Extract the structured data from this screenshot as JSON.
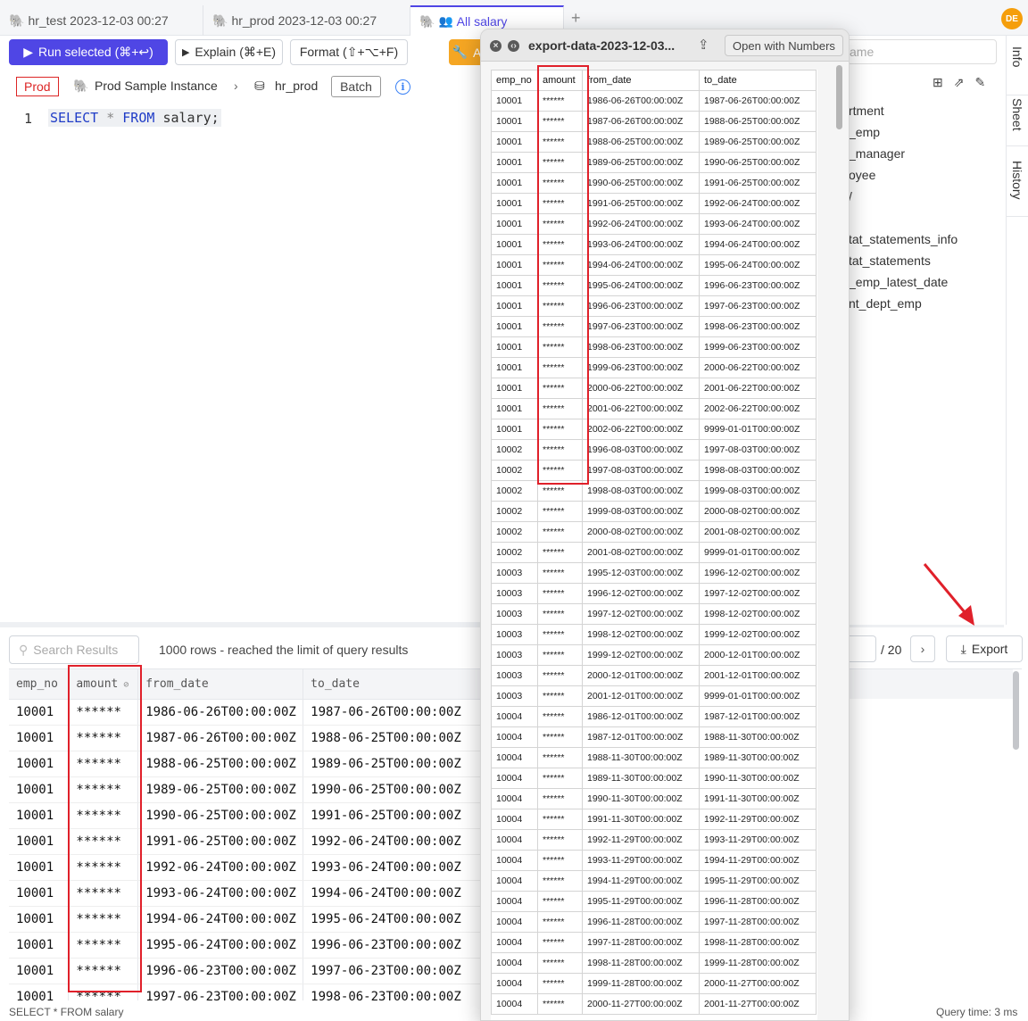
{
  "tabs": [
    {
      "label": "hr_test 2023-12-03 00:27",
      "icon": "postgres-icon"
    },
    {
      "label": "hr_prod 2023-12-03 00:27",
      "icon": "postgres-icon"
    },
    {
      "label": "All salary",
      "icon": "postgres-icon"
    }
  ],
  "user": {
    "initials": "DE"
  },
  "toolbar": {
    "run_label": "Run selected (⌘+↩)",
    "explain_label": "Explain (⌘+E)",
    "format_label": "Format (⇧+⌥+F)",
    "partial_label": "A"
  },
  "context": {
    "env": "Prod",
    "instance": "Prod Sample Instance",
    "database": "hr_prod",
    "batch": "Batch"
  },
  "editor": {
    "line": "1",
    "kw_select": "SELECT",
    "star": "*",
    "kw_from": "FROM",
    "table": "salary;"
  },
  "results": {
    "search_placeholder": "Search Results",
    "rows_info": "1000 rows  -  reached the limit of query results",
    "columns": [
      "emp_no",
      "amount",
      "from_date",
      "to_date"
    ],
    "rows": [
      [
        "10001",
        "******",
        "1986-06-26T00:00:00Z",
        "1987-06-26T00:00:00Z"
      ],
      [
        "10001",
        "******",
        "1987-06-26T00:00:00Z",
        "1988-06-25T00:00:00Z"
      ],
      [
        "10001",
        "******",
        "1988-06-25T00:00:00Z",
        "1989-06-25T00:00:00Z"
      ],
      [
        "10001",
        "******",
        "1989-06-25T00:00:00Z",
        "1990-06-25T00:00:00Z"
      ],
      [
        "10001",
        "******",
        "1990-06-25T00:00:00Z",
        "1991-06-25T00:00:00Z"
      ],
      [
        "10001",
        "******",
        "1991-06-25T00:00:00Z",
        "1992-06-24T00:00:00Z"
      ],
      [
        "10001",
        "******",
        "1992-06-24T00:00:00Z",
        "1993-06-24T00:00:00Z"
      ],
      [
        "10001",
        "******",
        "1993-06-24T00:00:00Z",
        "1994-06-24T00:00:00Z"
      ],
      [
        "10001",
        "******",
        "1994-06-24T00:00:00Z",
        "1995-06-24T00:00:00Z"
      ],
      [
        "10001",
        "******",
        "1995-06-24T00:00:00Z",
        "1996-06-23T00:00:00Z"
      ],
      [
        "10001",
        "******",
        "1996-06-23T00:00:00Z",
        "1997-06-23T00:00:00Z"
      ],
      [
        "10001",
        "******",
        "1997-06-23T00:00:00Z",
        "1998-06-23T00:00:00Z"
      ]
    ],
    "pager_total": "/ 20",
    "export_label": "Export"
  },
  "schema": {
    "search_placeholder": "ame",
    "items": [
      "rtment",
      "_emp",
      "_manager",
      "oyee",
      "/",
      "tat_statements_info",
      "tat_statements",
      "_emp_latest_date",
      "nt_dept_emp"
    ]
  },
  "side_tabs": [
    "Info",
    "Sheet",
    "History"
  ],
  "status": {
    "query": "SELECT * FROM salary",
    "time": "Query time: 3 ms"
  },
  "preview": {
    "filename": "export-data-2023-12-03...",
    "open_with": "Open with Numbers",
    "columns": [
      "emp_no",
      "amount",
      "from_date",
      "to_date"
    ],
    "rows": [
      [
        "10001",
        "******",
        "1986-06-26T00:00:00Z",
        "1987-06-26T00:00:00Z"
      ],
      [
        "10001",
        "******",
        "1987-06-26T00:00:00Z",
        "1988-06-25T00:00:00Z"
      ],
      [
        "10001",
        "******",
        "1988-06-25T00:00:00Z",
        "1989-06-25T00:00:00Z"
      ],
      [
        "10001",
        "******",
        "1989-06-25T00:00:00Z",
        "1990-06-25T00:00:00Z"
      ],
      [
        "10001",
        "******",
        "1990-06-25T00:00:00Z",
        "1991-06-25T00:00:00Z"
      ],
      [
        "10001",
        "******",
        "1991-06-25T00:00:00Z",
        "1992-06-24T00:00:00Z"
      ],
      [
        "10001",
        "******",
        "1992-06-24T00:00:00Z",
        "1993-06-24T00:00:00Z"
      ],
      [
        "10001",
        "******",
        "1993-06-24T00:00:00Z",
        "1994-06-24T00:00:00Z"
      ],
      [
        "10001",
        "******",
        "1994-06-24T00:00:00Z",
        "1995-06-24T00:00:00Z"
      ],
      [
        "10001",
        "******",
        "1995-06-24T00:00:00Z",
        "1996-06-23T00:00:00Z"
      ],
      [
        "10001",
        "******",
        "1996-06-23T00:00:00Z",
        "1997-06-23T00:00:00Z"
      ],
      [
        "10001",
        "******",
        "1997-06-23T00:00:00Z",
        "1998-06-23T00:00:00Z"
      ],
      [
        "10001",
        "******",
        "1998-06-23T00:00:00Z",
        "1999-06-23T00:00:00Z"
      ],
      [
        "10001",
        "******",
        "1999-06-23T00:00:00Z",
        "2000-06-22T00:00:00Z"
      ],
      [
        "10001",
        "******",
        "2000-06-22T00:00:00Z",
        "2001-06-22T00:00:00Z"
      ],
      [
        "10001",
        "******",
        "2001-06-22T00:00:00Z",
        "2002-06-22T00:00:00Z"
      ],
      [
        "10001",
        "******",
        "2002-06-22T00:00:00Z",
        "9999-01-01T00:00:00Z"
      ],
      [
        "10002",
        "******",
        "1996-08-03T00:00:00Z",
        "1997-08-03T00:00:00Z"
      ],
      [
        "10002",
        "******",
        "1997-08-03T00:00:00Z",
        "1998-08-03T00:00:00Z"
      ],
      [
        "10002",
        "******",
        "1998-08-03T00:00:00Z",
        "1999-08-03T00:00:00Z"
      ],
      [
        "10002",
        "******",
        "1999-08-03T00:00:00Z",
        "2000-08-02T00:00:00Z"
      ],
      [
        "10002",
        "******",
        "2000-08-02T00:00:00Z",
        "2001-08-02T00:00:00Z"
      ],
      [
        "10002",
        "******",
        "2001-08-02T00:00:00Z",
        "9999-01-01T00:00:00Z"
      ],
      [
        "10003",
        "******",
        "1995-12-03T00:00:00Z",
        "1996-12-02T00:00:00Z"
      ],
      [
        "10003",
        "******",
        "1996-12-02T00:00:00Z",
        "1997-12-02T00:00:00Z"
      ],
      [
        "10003",
        "******",
        "1997-12-02T00:00:00Z",
        "1998-12-02T00:00:00Z"
      ],
      [
        "10003",
        "******",
        "1998-12-02T00:00:00Z",
        "1999-12-02T00:00:00Z"
      ],
      [
        "10003",
        "******",
        "1999-12-02T00:00:00Z",
        "2000-12-01T00:00:00Z"
      ],
      [
        "10003",
        "******",
        "2000-12-01T00:00:00Z",
        "2001-12-01T00:00:00Z"
      ],
      [
        "10003",
        "******",
        "2001-12-01T00:00:00Z",
        "9999-01-01T00:00:00Z"
      ],
      [
        "10004",
        "******",
        "1986-12-01T00:00:00Z",
        "1987-12-01T00:00:00Z"
      ],
      [
        "10004",
        "******",
        "1987-12-01T00:00:00Z",
        "1988-11-30T00:00:00Z"
      ],
      [
        "10004",
        "******",
        "1988-11-30T00:00:00Z",
        "1989-11-30T00:00:00Z"
      ],
      [
        "10004",
        "******",
        "1989-11-30T00:00:00Z",
        "1990-11-30T00:00:00Z"
      ],
      [
        "10004",
        "******",
        "1990-11-30T00:00:00Z",
        "1991-11-30T00:00:00Z"
      ],
      [
        "10004",
        "******",
        "1991-11-30T00:00:00Z",
        "1992-11-29T00:00:00Z"
      ],
      [
        "10004",
        "******",
        "1992-11-29T00:00:00Z",
        "1993-11-29T00:00:00Z"
      ],
      [
        "10004",
        "******",
        "1993-11-29T00:00:00Z",
        "1994-11-29T00:00:00Z"
      ],
      [
        "10004",
        "******",
        "1994-11-29T00:00:00Z",
        "1995-11-29T00:00:00Z"
      ],
      [
        "10004",
        "******",
        "1995-11-29T00:00:00Z",
        "1996-11-28T00:00:00Z"
      ],
      [
        "10004",
        "******",
        "1996-11-28T00:00:00Z",
        "1997-11-28T00:00:00Z"
      ],
      [
        "10004",
        "******",
        "1997-11-28T00:00:00Z",
        "1998-11-28T00:00:00Z"
      ],
      [
        "10004",
        "******",
        "1998-11-28T00:00:00Z",
        "1999-11-28T00:00:00Z"
      ],
      [
        "10004",
        "******",
        "1999-11-28T00:00:00Z",
        "2000-11-27T00:00:00Z"
      ],
      [
        "10004",
        "******",
        "2000-11-27T00:00:00Z",
        "2001-11-27T00:00:00Z"
      ]
    ]
  },
  "colors": {
    "accent": "#4f46e5",
    "highlight": "#e0202a",
    "prod": "#dc2626"
  }
}
